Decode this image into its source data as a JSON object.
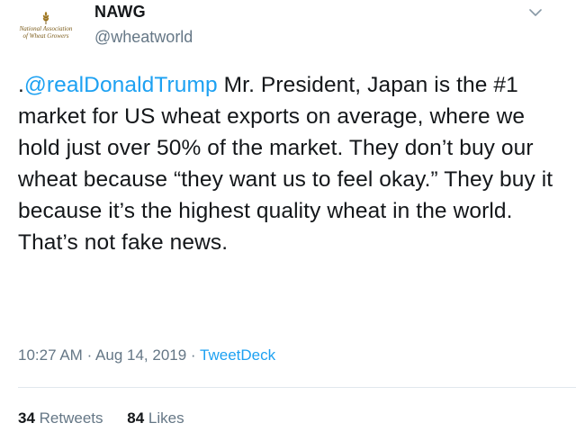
{
  "account": {
    "display_name": "NAWG",
    "handle": "@wheatworld",
    "logo_line1": "National Association",
    "logo_line2": "of Wheat Growers"
  },
  "tweet": {
    "mention": "@realDonaldTrump",
    "text_prefix": ".",
    "text_body": " Mr. President, Japan is the #1 market for US wheat exports on average, where we hold just over 50% of the market. They don’t buy our wheat because “they want us to feel okay.” They buy it because it’s the highest quality wheat in the world. That’s not fake news."
  },
  "meta": {
    "time": "10:27 AM",
    "date": "Aug 14, 2019",
    "separator": "·",
    "source": "TweetDeck"
  },
  "stats": {
    "retweets_count": "34",
    "retweets_label": "Retweets",
    "likes_count": "84",
    "likes_label": "Likes"
  },
  "colors": {
    "link": "#1da1f2",
    "muted": "#657786",
    "text": "#14171a",
    "logo": "#7a5a18"
  },
  "icons": {
    "caret": "chevron-down-icon",
    "logo": "wheat-icon"
  }
}
